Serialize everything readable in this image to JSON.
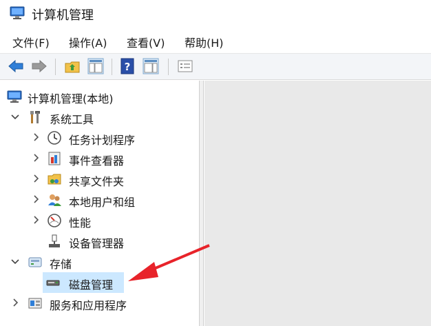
{
  "window": {
    "title": "计算机管理"
  },
  "menu": {
    "file": "文件(F)",
    "action": "操作(A)",
    "view": "查看(V)",
    "help": "帮助(H)"
  },
  "toolbar": {
    "icons": [
      "back-arrow-icon",
      "forward-arrow-icon",
      "up-folder-icon",
      "show-hide-console-tree-icon",
      "help-icon",
      "show-hide-action-pane-icon",
      "properties-icon"
    ]
  },
  "tree": {
    "root": "计算机管理(本地)",
    "system_tools": "系统工具",
    "task_scheduler": "任务计划程序",
    "event_viewer": "事件查看器",
    "shared_folders": "共享文件夹",
    "local_users": "本地用户和组",
    "performance": "性能",
    "device_manager": "设备管理器",
    "storage": "存储",
    "disk_management": "磁盘管理",
    "services_apps": "服务和应用程序"
  },
  "colors": {
    "selection": "#cce8ff",
    "annotation_arrow": "#e8232a",
    "right_pane": "#e9e9e9",
    "toolbar_bg": "#f3f5f8"
  }
}
